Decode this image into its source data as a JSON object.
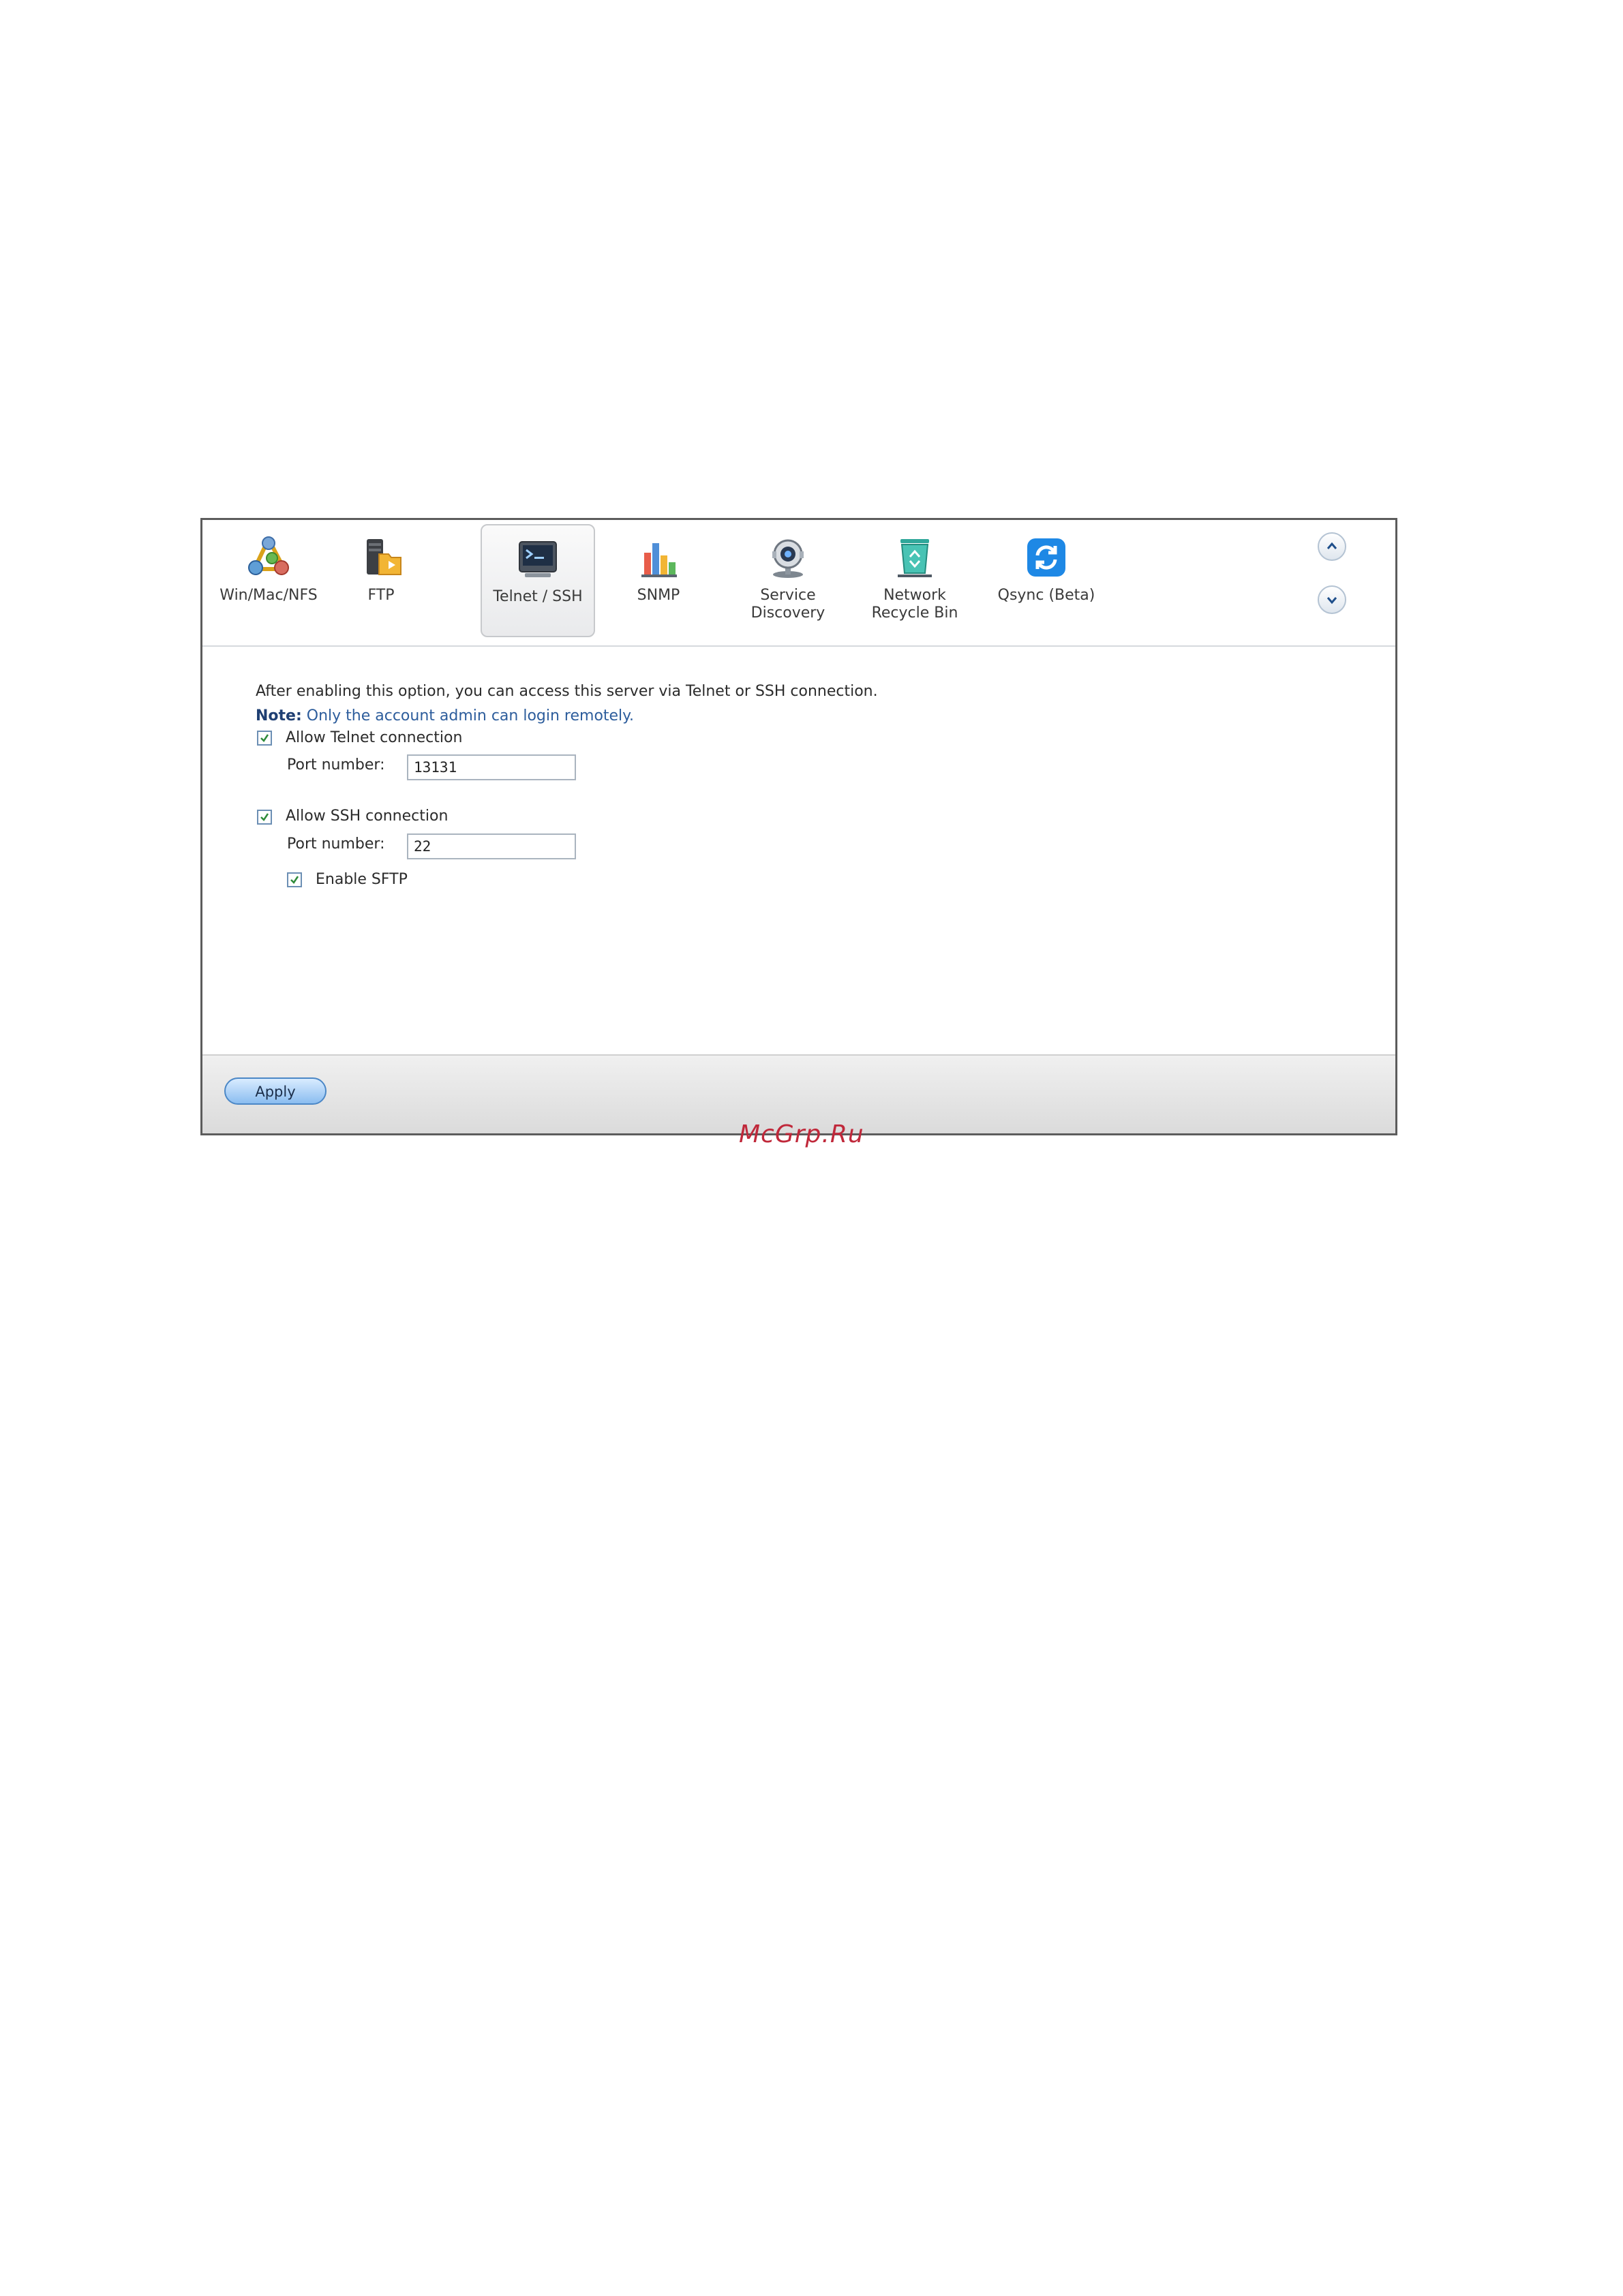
{
  "toolbar": {
    "tabs": [
      {
        "label": "Win/Mac/NFS",
        "icon": "network-share-icon"
      },
      {
        "label": "FTP",
        "icon": "ftp-server-icon"
      },
      {
        "label": "Telnet / SSH",
        "icon": "terminal-icon"
      },
      {
        "label": "SNMP",
        "icon": "bar-chart-icon"
      },
      {
        "label": "Service\nDiscovery",
        "icon": "webcam-icon"
      },
      {
        "label": "Network\nRecycle Bin",
        "icon": "recycle-bin-icon"
      },
      {
        "label": "Qsync (Beta)",
        "icon": "sync-icon"
      }
    ],
    "active_tab": "Telnet / SSH",
    "scroll_up_icon": "chevron-up-icon",
    "scroll_down_icon": "chevron-down-icon"
  },
  "content": {
    "description": "After enabling this option, you can access this server via Telnet or SSH connection.",
    "note_label": "Note:",
    "note_text": "Only the account admin can login remotely.",
    "telnet": {
      "checkbox_label": "Allow Telnet connection",
      "checked": true,
      "port_label": "Port number:",
      "port_value": "13131"
    },
    "ssh": {
      "checkbox_label": "Allow SSH connection",
      "checked": true,
      "port_label": "Port number:",
      "port_value": "22",
      "sftp_label": "Enable SFTP",
      "sftp_checked": true
    }
  },
  "footer": {
    "apply_label": "Apply"
  },
  "watermark": "McGrp.Ru",
  "colors": {
    "accent": "#4b87c6",
    "note": "#2d5d9c",
    "watermark": "#c0283a"
  }
}
